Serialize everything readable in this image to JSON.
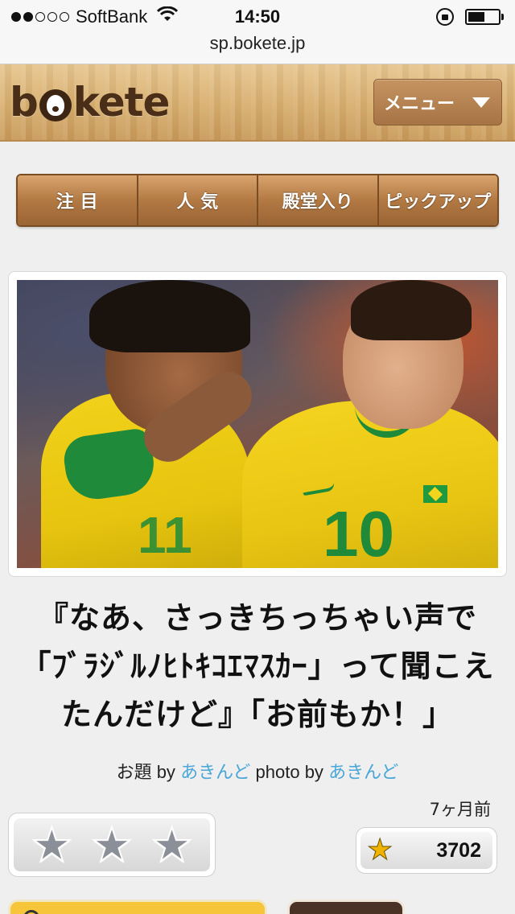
{
  "status_bar": {
    "carrier": "SoftBank",
    "time": "14:50",
    "signal_filled": 2,
    "signal_total": 5,
    "battery_level": 0.55
  },
  "browser": {
    "url": "sp.bokete.jp"
  },
  "header": {
    "logo_text": "bokete",
    "menu_label": "メニュー"
  },
  "tabs": [
    {
      "label": "注 目"
    },
    {
      "label": "人 気"
    },
    {
      "label": "殿堂入り"
    },
    {
      "label": "ピックアップ"
    }
  ],
  "post": {
    "caption": "『なあ、さっきちっちゃい声で「ﾌﾞﾗｼﾞﾙﾉﾋﾄｷｺｴﾏｽｶｰ」って聞こえたんだけど』「お前もか！」",
    "credit_prefix": "お題 by",
    "odai_author": "あきんど",
    "photo_prefix": "photo by",
    "photo_author": "あきんど",
    "time_ago": "7ヶ月前",
    "score": "3702",
    "rating_stars": 3
  },
  "colors": {
    "link": "#4aa7d8",
    "wood": "#d7ae6e",
    "star_gold": "#f0b400"
  },
  "icons": [
    "wifi-icon",
    "rotation-lock-icon",
    "battery-icon",
    "chevron-down-icon",
    "star-icon"
  ]
}
